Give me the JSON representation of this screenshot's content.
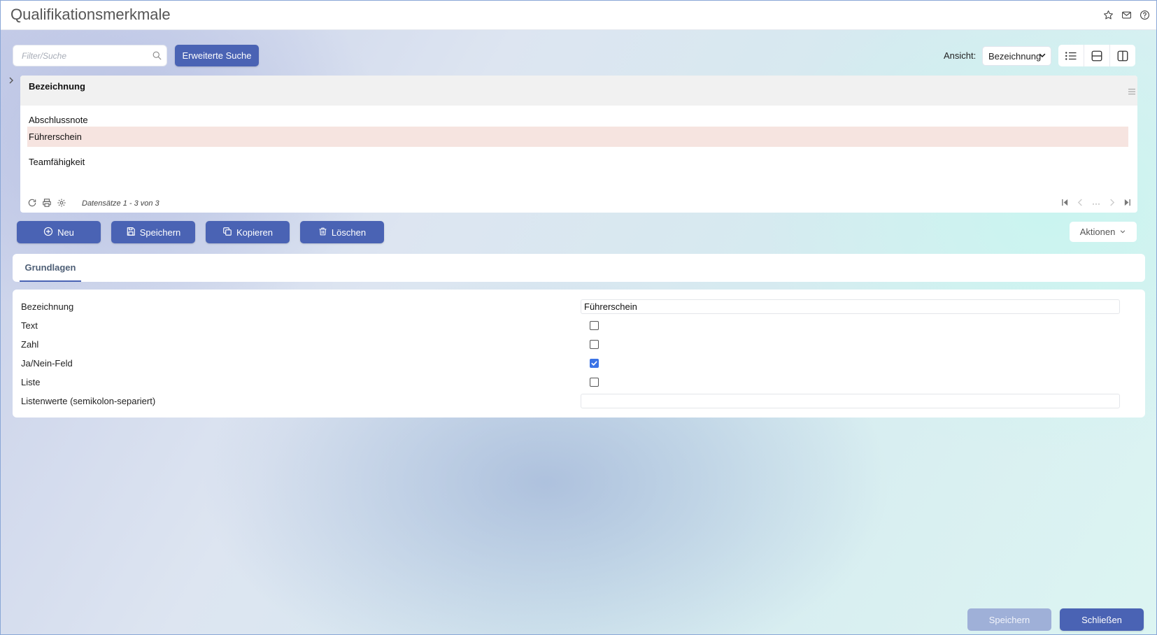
{
  "header": {
    "title": "Qualifikationsmerkmale",
    "icons": [
      "star-icon",
      "mail-icon",
      "help-icon"
    ]
  },
  "search": {
    "placeholder": "Filter/Suche",
    "value": "",
    "advanced_label": "Erweiterte Suche"
  },
  "view": {
    "label": "Ansicht:",
    "selected": "Bezeichnung",
    "modes": [
      "list-view-icon",
      "split-horizontal-icon",
      "split-vertical-icon"
    ]
  },
  "grid": {
    "columns": [
      "Bezeichnung"
    ],
    "rows": [
      "Abschlussnote",
      "Führerschein",
      "Teamfähigkeit"
    ],
    "selected_row": 1,
    "records_text": "Datensätze 1 - 3 von 3",
    "pager_ellipsis": "···"
  },
  "actions": {
    "new": "Neu",
    "save": "Speichern",
    "copy": "Kopieren",
    "delete": "Löschen",
    "more": "Aktionen"
  },
  "tabs": {
    "active": "Grundlagen"
  },
  "form": {
    "bezeichnung": {
      "label": "Bezeichnung",
      "value": "Führerschein"
    },
    "text": {
      "label": "Text",
      "checked": false
    },
    "zahl": {
      "label": "Zahl",
      "checked": false
    },
    "ja_nein": {
      "label": "Ja/Nein-Feld",
      "checked": true
    },
    "liste": {
      "label": "Liste",
      "checked": false
    },
    "listenwerte": {
      "label": "Listenwerte (semikolon-separiert)",
      "value": ""
    }
  },
  "footer": {
    "save": "Speichern",
    "close": "Schließen"
  },
  "colors": {
    "primary": "#4a63b4",
    "selected_row": "#f6e4e0",
    "disabled_button": "#9fb0d8"
  }
}
